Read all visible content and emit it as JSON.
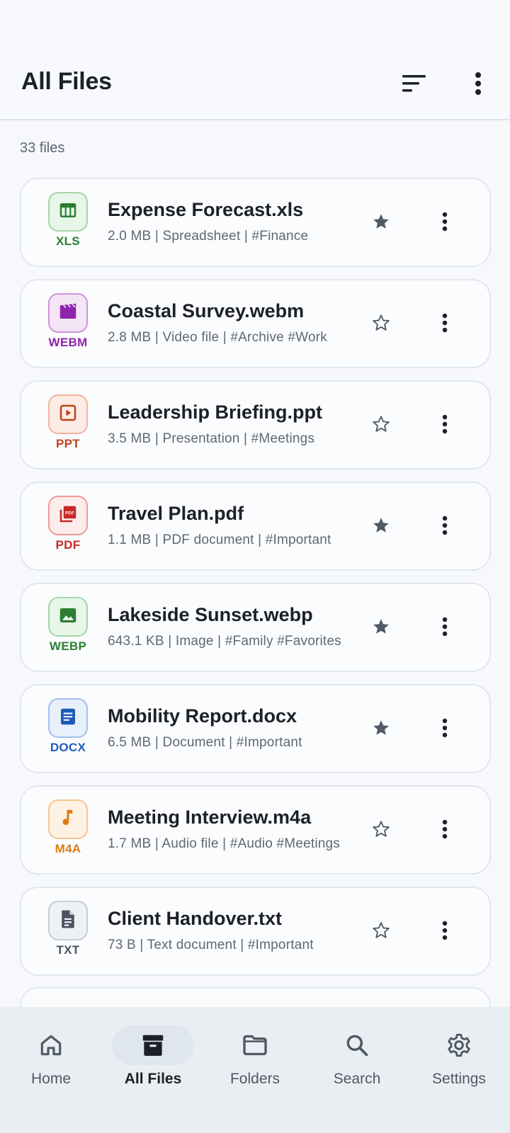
{
  "header": {
    "title": "All Files",
    "sort_icon": "sort-icon",
    "menu_icon": "more-vert-icon"
  },
  "file_count": "33 files",
  "files": [
    {
      "type_label": "XLS",
      "icon": "table-icon",
      "color": "#2e7d32",
      "bg": "#e8f5e9",
      "border": "#a5d6a7",
      "name": "Expense Forecast.xls",
      "meta": "2.0 MB | Spreadsheet | #Finance",
      "starred": true
    },
    {
      "type_label": "WEBM",
      "icon": "movie-icon",
      "color": "#8e24aa",
      "bg": "#f3e5f5",
      "border": "#ce93d8",
      "name": "Coastal Survey.webm",
      "meta": "2.8 MB | Video file | #Archive  #Work",
      "starred": false
    },
    {
      "type_label": "PPT",
      "icon": "slideshow-icon",
      "color": "#c0431a",
      "bg": "#fdece6",
      "border": "#f3b49e",
      "name": "Leadership Briefing.ppt",
      "meta": "3.5 MB | Presentation | #Meetings",
      "starred": false
    },
    {
      "type_label": "PDF",
      "icon": "pdf-icon",
      "color": "#c62828",
      "bg": "#fdecec",
      "border": "#ef9a9a",
      "name": "Travel Plan.pdf",
      "meta": "1.1 MB | PDF document | #Important",
      "starred": true
    },
    {
      "type_label": "WEBP",
      "icon": "image-icon",
      "color": "#2e7d32",
      "bg": "#e8f5e9",
      "border": "#a5d6a7",
      "name": "Lakeside Sunset.webp",
      "meta": "643.1 KB | Image | #Family  #Favorites",
      "starred": true
    },
    {
      "type_label": "DOCX",
      "icon": "document-icon",
      "color": "#1e5bb8",
      "bg": "#e8f0fc",
      "border": "#9ec0ef",
      "name": "Mobility Report.docx",
      "meta": "6.5 MB | Document | #Important",
      "starred": true
    },
    {
      "type_label": "M4A",
      "icon": "music-note-icon",
      "color": "#e07b12",
      "bg": "#fdf1e4",
      "border": "#f6c58d",
      "name": "Meeting Interview.m4a",
      "meta": "1.7 MB | Audio file | #Audio  #Meetings",
      "starred": false
    },
    {
      "type_label": "TXT",
      "icon": "text-file-icon",
      "color": "#4b5560",
      "bg": "#eef1f4",
      "border": "#c5ccd4",
      "name": "Client Handover.txt",
      "meta": "73 B | Text document | #Important",
      "starred": false
    }
  ],
  "nav": [
    {
      "label": "Home",
      "icon": "home-icon",
      "active": false
    },
    {
      "label": "All Files",
      "icon": "archive-icon",
      "active": true
    },
    {
      "label": "Folders",
      "icon": "folder-icon",
      "active": false
    },
    {
      "label": "Search",
      "icon": "search-icon",
      "active": false
    },
    {
      "label": "Settings",
      "icon": "gear-icon",
      "active": false
    }
  ]
}
